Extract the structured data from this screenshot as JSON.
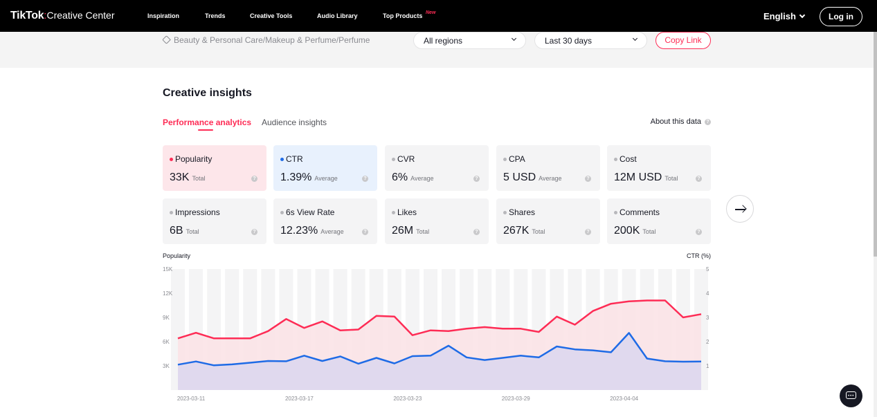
{
  "header": {
    "logo_brand": "TikTok",
    "logo_sep": ":",
    "logo_sub": "Creative Center",
    "nav": [
      "Inspiration",
      "Trends",
      "Creative Tools",
      "Audio Library",
      "Top Products"
    ],
    "new_badge": "New",
    "language": "English",
    "login": "Log in"
  },
  "filters": {
    "breadcrumb": "Beauty & Personal Care/Makeup & Perfume/Perfume",
    "region": "All regions",
    "period": "Last 30 days",
    "copy_link": "Copy Link"
  },
  "insights": {
    "title": "Creative insights",
    "tabs": [
      "Performance analytics",
      "Audience insights"
    ],
    "about": "About this data",
    "help_glyph": "?"
  },
  "metrics": [
    {
      "label": "Popularity",
      "value": "33K",
      "unit": "Total",
      "dot_color": "#fe2c55"
    },
    {
      "label": "CTR",
      "value": "1.39%",
      "unit": "Average",
      "dot_color": "#1e6be6"
    },
    {
      "label": "CVR",
      "value": "6%",
      "unit": "Average",
      "dot_color": "#b7b7bb"
    },
    {
      "label": "CPA",
      "value": "5 USD",
      "unit": "Average",
      "dot_color": "#b7b7bb"
    },
    {
      "label": "Cost",
      "value": "12M USD",
      "unit": "Total",
      "dot_color": "#b7b7bb"
    },
    {
      "label": "Impressions",
      "value": "6B",
      "unit": "Total",
      "dot_color": "#b7b7bb"
    },
    {
      "label": "6s View Rate",
      "value": "12.23%",
      "unit": "Average",
      "dot_color": "#b7b7bb"
    },
    {
      "label": "Likes",
      "value": "26M",
      "unit": "Total",
      "dot_color": "#b7b7bb"
    },
    {
      "label": "Shares",
      "value": "267K",
      "unit": "Total",
      "dot_color": "#b7b7bb"
    },
    {
      "label": "Comments",
      "value": "200K",
      "unit": "Total",
      "dot_color": "#b7b7bb"
    }
  ],
  "colors": {
    "accent": "#fe2c55",
    "ctr_line": "#1e6be6",
    "popularity_fill": "#fbe3e7",
    "ctr_fill": "#e0d9ee",
    "bar": "#f4f4f5"
  },
  "chart_data": {
    "type": "line",
    "xlabel": "",
    "ylabel": "Popularity",
    "ylabel_right": "CTR (%)",
    "ylim": [
      0,
      15000
    ],
    "ylim_right": [
      0,
      5
    ],
    "yticks": [
      "15K",
      "12K",
      "9K",
      "6K",
      "3K"
    ],
    "yticks_right": [
      "5",
      "4",
      "3",
      "2",
      "1"
    ],
    "x": [
      "2023-03-11",
      "2023-03-12",
      "2023-03-13",
      "2023-03-14",
      "2023-03-15",
      "2023-03-16",
      "2023-03-17",
      "2023-03-18",
      "2023-03-19",
      "2023-03-20",
      "2023-03-21",
      "2023-03-22",
      "2023-03-23",
      "2023-03-24",
      "2023-03-25",
      "2023-03-26",
      "2023-03-27",
      "2023-03-28",
      "2023-03-29",
      "2023-03-30",
      "2023-03-31",
      "2023-04-01",
      "2023-04-02",
      "2023-04-03",
      "2023-04-04",
      "2023-04-05",
      "2023-04-06",
      "2023-04-07",
      "2023-04-08",
      "2023-04-09"
    ],
    "xtick_labels": [
      "2023-03-11",
      "2023-03-17",
      "2023-03-23",
      "2023-03-29",
      "2023-04-04"
    ],
    "series": [
      {
        "name": "Popularity",
        "axis": "left",
        "values": [
          6400,
          7100,
          6400,
          6400,
          6400,
          7300,
          8800,
          7700,
          8500,
          7400,
          7500,
          9200,
          9100,
          6800,
          7400,
          7300,
          7600,
          7800,
          7600,
          7600,
          7200,
          9100,
          8100,
          9800,
          10700,
          11000,
          11100,
          11100,
          9000,
          9400
        ]
      },
      {
        "name": "CTR",
        "axis": "right",
        "values": [
          1.05,
          1.18,
          1.02,
          1.06,
          1.13,
          1.2,
          1.19,
          1.42,
          1.2,
          1.39,
          1.09,
          1.33,
          1.1,
          1.4,
          1.42,
          1.83,
          1.35,
          1.24,
          1.33,
          1.42,
          1.35,
          1.8,
          1.68,
          1.64,
          1.56,
          2.36,
          1.3,
          1.19,
          1.17,
          1.18
        ]
      }
    ]
  }
}
